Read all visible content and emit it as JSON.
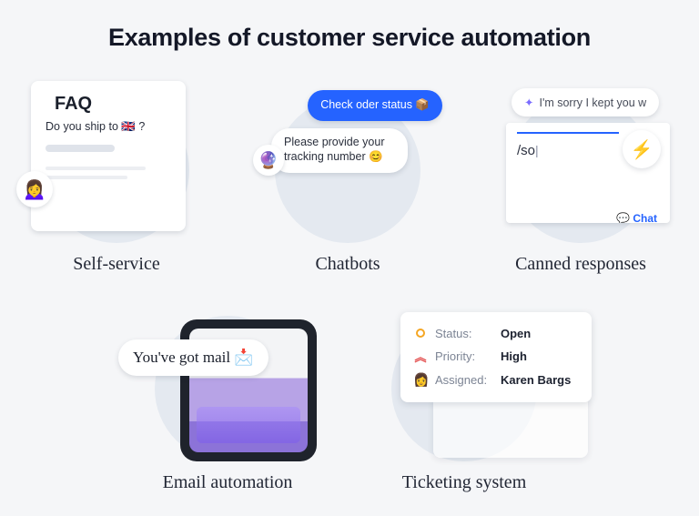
{
  "title": "Examples of customer service automation",
  "items": [
    {
      "label": "Self-service",
      "faq": {
        "heading": "FAQ",
        "question": "Do you ship to 🇬🇧 ?",
        "avatar_emoji": "🙍‍♀️"
      }
    },
    {
      "label": "Chatbots",
      "chat": {
        "blue_bubble": "Check oder status 📦",
        "white_bubble": "Please provide your tracking number 😊",
        "bot_emoji": "🔮"
      }
    },
    {
      "label": "Canned responses",
      "canned": {
        "pill_text": "I'm sorry I kept you w",
        "slash_input": "/so",
        "bottom_tag": "Chat",
        "bolt_icon": "⚡",
        "spark_icon": "✦"
      }
    },
    {
      "label": "Email automation",
      "email": {
        "pill_text": "You've got mail 📩"
      }
    },
    {
      "label": "Ticketing system",
      "ticket": {
        "rows": [
          {
            "icon": "dot-open",
            "label": "Status:",
            "value": "Open"
          },
          {
            "icon": "priority",
            "label": "Priority:",
            "value": "High"
          },
          {
            "icon": "avatar",
            "label": "Assigned:",
            "value": "Karen Bargs"
          }
        ]
      }
    }
  ]
}
